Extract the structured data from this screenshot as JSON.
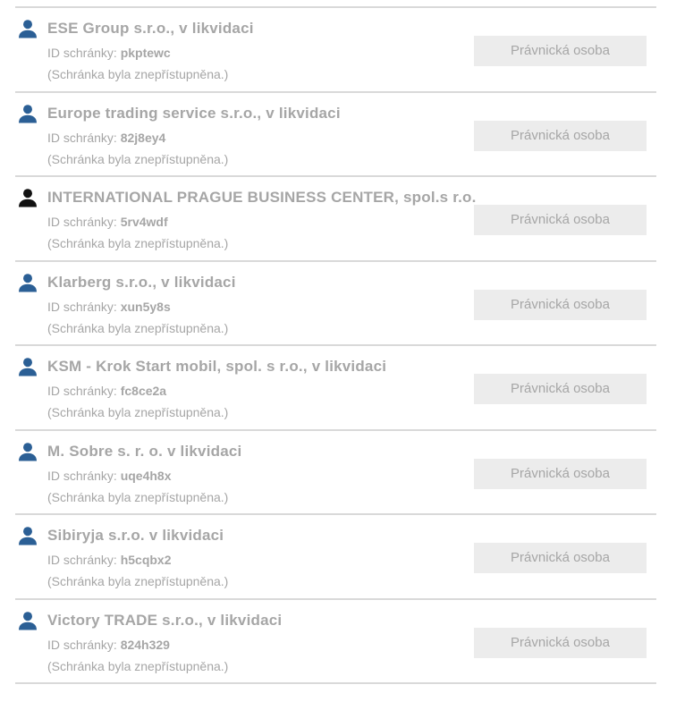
{
  "colors": {
    "icon_blue": "#2b5f95",
    "icon_black": "#111111",
    "text_gray": "#a6a6a6",
    "badge_bg": "#ececec",
    "divider": "#d9d9d9"
  },
  "items": [
    {
      "name": "ESE Group s.r.o., v likvidaci",
      "id_label": "ID schránky: ",
      "id_value": "pkptewc",
      "note": "(Schránka byla znepřístupněna.)",
      "type": "Právnická osoba",
      "icon": "person-icon",
      "icon_color": "#2b5f95"
    },
    {
      "name": "Europe trading service s.r.o., v likvidaci",
      "id_label": "ID schránky: ",
      "id_value": "82j8ey4",
      "note": "(Schránka byla znepřístupněna.)",
      "type": "Právnická osoba",
      "icon": "person-icon",
      "icon_color": "#2b5f95"
    },
    {
      "name": "INTERNATIONAL PRAGUE BUSINESS CENTER, spol.s r.o.",
      "id_label": "ID schránky: ",
      "id_value": "5rv4wdf",
      "note": "(Schránka byla znepřístupněna.)",
      "type": "Právnická osoba",
      "icon": "person-icon",
      "icon_color": "#111111"
    },
    {
      "name": "Klarberg s.r.o., v likvidaci",
      "id_label": "ID schránky: ",
      "id_value": "xun5y8s",
      "note": "(Schránka byla znepřístupněna.)",
      "type": "Právnická osoba",
      "icon": "person-icon",
      "icon_color": "#2b5f95"
    },
    {
      "name": "KSM - Krok Start mobil, spol. s r.o., v likvidaci",
      "id_label": "ID schránky: ",
      "id_value": "fc8ce2a",
      "note": "(Schránka byla znepřístupněna.)",
      "type": "Právnická osoba",
      "icon": "person-icon",
      "icon_color": "#2b5f95"
    },
    {
      "name": "M. Sobre s. r. o. v likvidaci",
      "id_label": "ID schránky: ",
      "id_value": "uqe4h8x",
      "note": "(Schránka byla znepřístupněna.)",
      "type": "Právnická osoba",
      "icon": "person-icon",
      "icon_color": "#2b5f95"
    },
    {
      "name": "Sibiryja s.r.o. v likvidaci",
      "id_label": "ID schránky: ",
      "id_value": "h5cqbx2",
      "note": "(Schránka byla znepřístupněna.)",
      "type": "Právnická osoba",
      "icon": "person-icon",
      "icon_color": "#2b5f95"
    },
    {
      "name": "Victory TRADE s.r.o., v likvidaci",
      "id_label": "ID schránky: ",
      "id_value": "824h329",
      "note": "(Schránka byla znepřístupněna.)",
      "type": "Právnická osoba",
      "icon": "person-icon",
      "icon_color": "#2b5f95"
    }
  ]
}
